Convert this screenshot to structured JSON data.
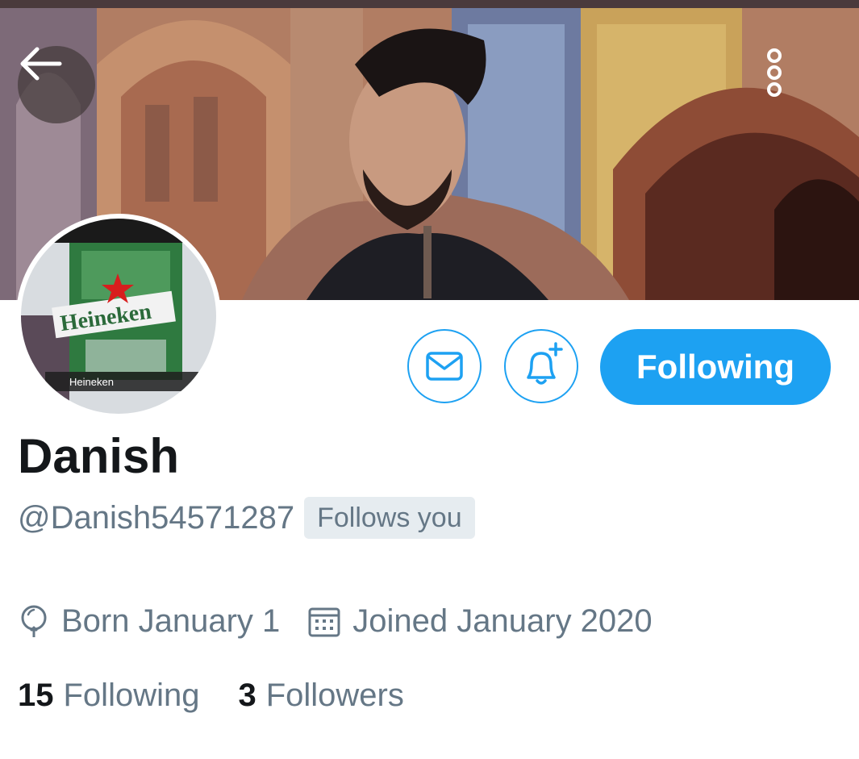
{
  "header": {
    "back_icon": "arrow-left-icon",
    "more_icon": "more-vertical-icon"
  },
  "avatar": {
    "label_text": "Heineken",
    "caption": "Heineken"
  },
  "actions": {
    "message_icon": "envelope-icon",
    "notify_icon": "bell-plus-icon",
    "follow_label": "Following"
  },
  "profile": {
    "name": "Danish",
    "handle": "@Danish54571287",
    "follows_you": "Follows you",
    "birthday": "Born January 1",
    "joined": "Joined January 2020"
  },
  "stats": {
    "following_count": "15",
    "following_label": "Following",
    "followers_count": "3",
    "followers_label": "Followers"
  },
  "colors": {
    "accent": "#1da1f2",
    "text_primary": "#14171a",
    "text_secondary": "#657786",
    "badge_bg": "#e6ecf0"
  }
}
